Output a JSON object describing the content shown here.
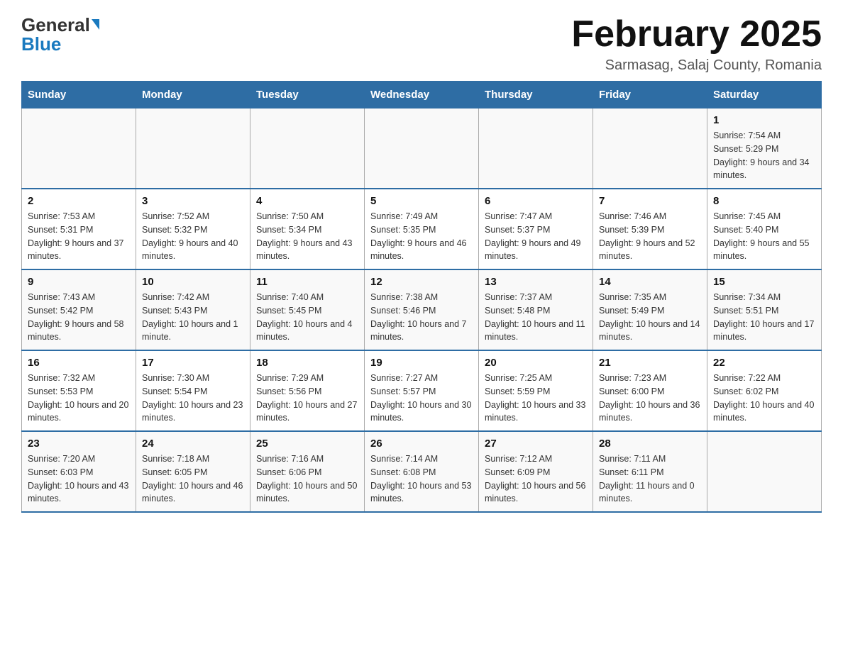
{
  "header": {
    "logo_general": "General",
    "logo_blue": "Blue",
    "title": "February 2025",
    "subtitle": "Sarmasag, Salaj County, Romania"
  },
  "weekdays": [
    "Sunday",
    "Monday",
    "Tuesday",
    "Wednesday",
    "Thursday",
    "Friday",
    "Saturday"
  ],
  "rows": [
    [
      {
        "day": "",
        "sunrise": "",
        "sunset": "",
        "daylight": ""
      },
      {
        "day": "",
        "sunrise": "",
        "sunset": "",
        "daylight": ""
      },
      {
        "day": "",
        "sunrise": "",
        "sunset": "",
        "daylight": ""
      },
      {
        "day": "",
        "sunrise": "",
        "sunset": "",
        "daylight": ""
      },
      {
        "day": "",
        "sunrise": "",
        "sunset": "",
        "daylight": ""
      },
      {
        "day": "",
        "sunrise": "",
        "sunset": "",
        "daylight": ""
      },
      {
        "day": "1",
        "sunrise": "Sunrise: 7:54 AM",
        "sunset": "Sunset: 5:29 PM",
        "daylight": "Daylight: 9 hours and 34 minutes."
      }
    ],
    [
      {
        "day": "2",
        "sunrise": "Sunrise: 7:53 AM",
        "sunset": "Sunset: 5:31 PM",
        "daylight": "Daylight: 9 hours and 37 minutes."
      },
      {
        "day": "3",
        "sunrise": "Sunrise: 7:52 AM",
        "sunset": "Sunset: 5:32 PM",
        "daylight": "Daylight: 9 hours and 40 minutes."
      },
      {
        "day": "4",
        "sunrise": "Sunrise: 7:50 AM",
        "sunset": "Sunset: 5:34 PM",
        "daylight": "Daylight: 9 hours and 43 minutes."
      },
      {
        "day": "5",
        "sunrise": "Sunrise: 7:49 AM",
        "sunset": "Sunset: 5:35 PM",
        "daylight": "Daylight: 9 hours and 46 minutes."
      },
      {
        "day": "6",
        "sunrise": "Sunrise: 7:47 AM",
        "sunset": "Sunset: 5:37 PM",
        "daylight": "Daylight: 9 hours and 49 minutes."
      },
      {
        "day": "7",
        "sunrise": "Sunrise: 7:46 AM",
        "sunset": "Sunset: 5:39 PM",
        "daylight": "Daylight: 9 hours and 52 minutes."
      },
      {
        "day": "8",
        "sunrise": "Sunrise: 7:45 AM",
        "sunset": "Sunset: 5:40 PM",
        "daylight": "Daylight: 9 hours and 55 minutes."
      }
    ],
    [
      {
        "day": "9",
        "sunrise": "Sunrise: 7:43 AM",
        "sunset": "Sunset: 5:42 PM",
        "daylight": "Daylight: 9 hours and 58 minutes."
      },
      {
        "day": "10",
        "sunrise": "Sunrise: 7:42 AM",
        "sunset": "Sunset: 5:43 PM",
        "daylight": "Daylight: 10 hours and 1 minute."
      },
      {
        "day": "11",
        "sunrise": "Sunrise: 7:40 AM",
        "sunset": "Sunset: 5:45 PM",
        "daylight": "Daylight: 10 hours and 4 minutes."
      },
      {
        "day": "12",
        "sunrise": "Sunrise: 7:38 AM",
        "sunset": "Sunset: 5:46 PM",
        "daylight": "Daylight: 10 hours and 7 minutes."
      },
      {
        "day": "13",
        "sunrise": "Sunrise: 7:37 AM",
        "sunset": "Sunset: 5:48 PM",
        "daylight": "Daylight: 10 hours and 11 minutes."
      },
      {
        "day": "14",
        "sunrise": "Sunrise: 7:35 AM",
        "sunset": "Sunset: 5:49 PM",
        "daylight": "Daylight: 10 hours and 14 minutes."
      },
      {
        "day": "15",
        "sunrise": "Sunrise: 7:34 AM",
        "sunset": "Sunset: 5:51 PM",
        "daylight": "Daylight: 10 hours and 17 minutes."
      }
    ],
    [
      {
        "day": "16",
        "sunrise": "Sunrise: 7:32 AM",
        "sunset": "Sunset: 5:53 PM",
        "daylight": "Daylight: 10 hours and 20 minutes."
      },
      {
        "day": "17",
        "sunrise": "Sunrise: 7:30 AM",
        "sunset": "Sunset: 5:54 PM",
        "daylight": "Daylight: 10 hours and 23 minutes."
      },
      {
        "day": "18",
        "sunrise": "Sunrise: 7:29 AM",
        "sunset": "Sunset: 5:56 PM",
        "daylight": "Daylight: 10 hours and 27 minutes."
      },
      {
        "day": "19",
        "sunrise": "Sunrise: 7:27 AM",
        "sunset": "Sunset: 5:57 PM",
        "daylight": "Daylight: 10 hours and 30 minutes."
      },
      {
        "day": "20",
        "sunrise": "Sunrise: 7:25 AM",
        "sunset": "Sunset: 5:59 PM",
        "daylight": "Daylight: 10 hours and 33 minutes."
      },
      {
        "day": "21",
        "sunrise": "Sunrise: 7:23 AM",
        "sunset": "Sunset: 6:00 PM",
        "daylight": "Daylight: 10 hours and 36 minutes."
      },
      {
        "day": "22",
        "sunrise": "Sunrise: 7:22 AM",
        "sunset": "Sunset: 6:02 PM",
        "daylight": "Daylight: 10 hours and 40 minutes."
      }
    ],
    [
      {
        "day": "23",
        "sunrise": "Sunrise: 7:20 AM",
        "sunset": "Sunset: 6:03 PM",
        "daylight": "Daylight: 10 hours and 43 minutes."
      },
      {
        "day": "24",
        "sunrise": "Sunrise: 7:18 AM",
        "sunset": "Sunset: 6:05 PM",
        "daylight": "Daylight: 10 hours and 46 minutes."
      },
      {
        "day": "25",
        "sunrise": "Sunrise: 7:16 AM",
        "sunset": "Sunset: 6:06 PM",
        "daylight": "Daylight: 10 hours and 50 minutes."
      },
      {
        "day": "26",
        "sunrise": "Sunrise: 7:14 AM",
        "sunset": "Sunset: 6:08 PM",
        "daylight": "Daylight: 10 hours and 53 minutes."
      },
      {
        "day": "27",
        "sunrise": "Sunrise: 7:12 AM",
        "sunset": "Sunset: 6:09 PM",
        "daylight": "Daylight: 10 hours and 56 minutes."
      },
      {
        "day": "28",
        "sunrise": "Sunrise: 7:11 AM",
        "sunset": "Sunset: 6:11 PM",
        "daylight": "Daylight: 11 hours and 0 minutes."
      },
      {
        "day": "",
        "sunrise": "",
        "sunset": "",
        "daylight": ""
      }
    ]
  ]
}
